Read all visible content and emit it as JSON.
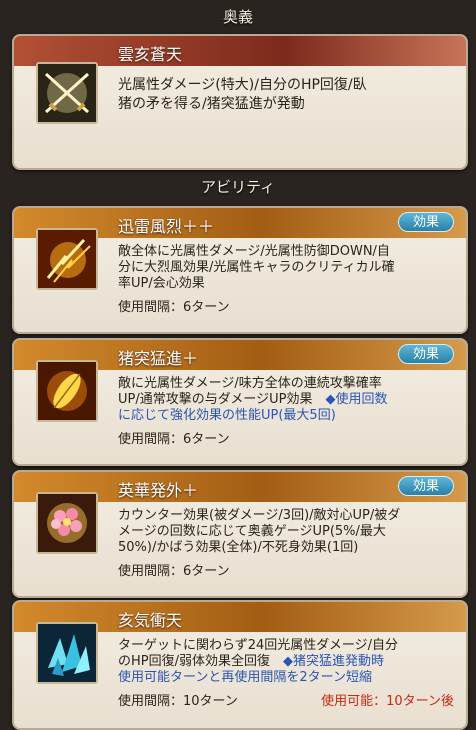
{
  "ougi_header": "奥義",
  "ability_header": "アビリティ",
  "ougi": {
    "name": "雲亥蒼天",
    "desc_lines": [
      "光属性ダメージ(特大)/自分のHP回復/臥",
      "猪の矛を得る/猪突猛進が発動"
    ],
    "icon": "crossed-swords-icon"
  },
  "effect_label": "効果",
  "abilities": [
    {
      "name": "迅雷風烈＋＋",
      "icon": "lightning-claw-icon",
      "desc_lines": [
        "敵全体に光属性ダメージ/光属性防御DOWN/自",
        "分に大烈風効果/光属性キャラのクリティカル確",
        "率UP/会心効果"
      ],
      "cooldown": "使用間隔：6ターン"
    },
    {
      "name": "猪突猛進＋",
      "icon": "golden-leaf-icon",
      "desc_lines": [
        "敵に光属性ダメージ/味方全体の連続攻撃確率",
        "UP/通常攻撃の与ダメージUP効果"
      ],
      "note_inline": "◆使用回数",
      "note_lines": [
        "に応じて強化効果の性能UP(最大5回)"
      ],
      "cooldown": "使用間隔：6ターン"
    },
    {
      "name": "英華発外＋",
      "icon": "pink-flower-icon",
      "desc_lines": [
        "カウンター効果(被ダメージ/3回)/敵対心UP/被ダ",
        "メージの回数に応じて奥義ゲージUP(5%/最大",
        "50%)/かばう効果(全体)/不死身効果(1回)"
      ],
      "cooldown": "使用間隔：6ターン"
    },
    {
      "name": "亥気衝天",
      "icon": "blue-crystal-icon",
      "desc_lines": [
        "ターゲットに関わらず24回光属性ダメージ/自分",
        "のHP回復/弱体効果全回復"
      ],
      "note_inline": "◆猪突猛進発動時",
      "note_lines": [
        "使用可能ターンと再使用間隔を2ターン短縮"
      ],
      "cooldown": "使用間隔：10ターン",
      "available": "使用可能：10ターン後"
    }
  ]
}
